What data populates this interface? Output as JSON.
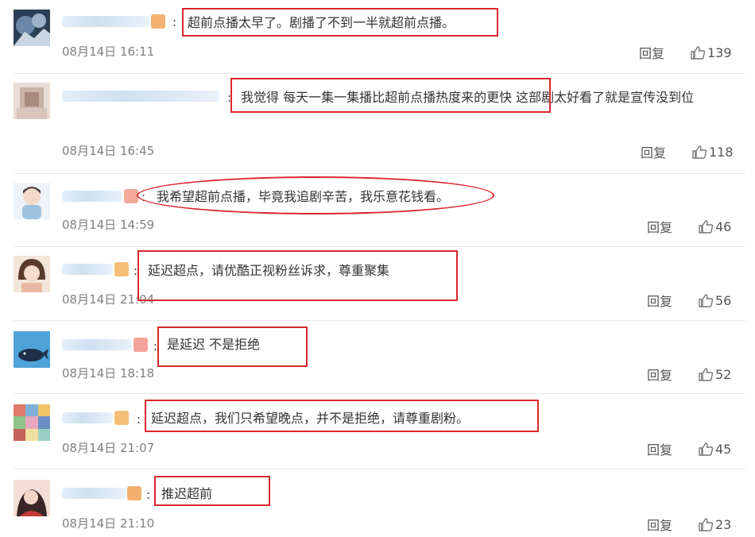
{
  "comments": [
    {
      "text": "超前点播太早了。剧播了不到一半就超前点播。",
      "time": "08月14日 16:11",
      "reply": "回复",
      "likes": "139"
    },
    {
      "text": "我觉得 每天一集一集播比超前点播热度来的更快 这部剧太好看了就是宣传没到位",
      "time": "08月14日 16:45",
      "reply": "回复",
      "likes": "118"
    },
    {
      "text": "我希望超前点播，毕竟我追剧辛苦，我乐意花钱看。",
      "time": "08月14日 14:59",
      "reply": "回复",
      "likes": "46"
    },
    {
      "text": "延迟超点，请优酷正视粉丝诉求，尊重聚集",
      "time": "08月14日 21:04",
      "reply": "回复",
      "likes": "56"
    },
    {
      "text": "是延迟 不是拒绝",
      "time": "08月14日 18:18",
      "reply": "回复",
      "likes": "52"
    },
    {
      "text": "延迟超点，我们只希望晚点，并不是拒绝，请尊重剧粉。",
      "time": "08月14日 21:07",
      "reply": "回复",
      "likes": "45"
    },
    {
      "text": "推迟超前",
      "time": "08月14日 21:10",
      "reply": "回复",
      "likes": "23"
    }
  ],
  "colon": ":",
  "colors": {
    "highlight": "#d8282e",
    "timestamp": "#808080"
  }
}
